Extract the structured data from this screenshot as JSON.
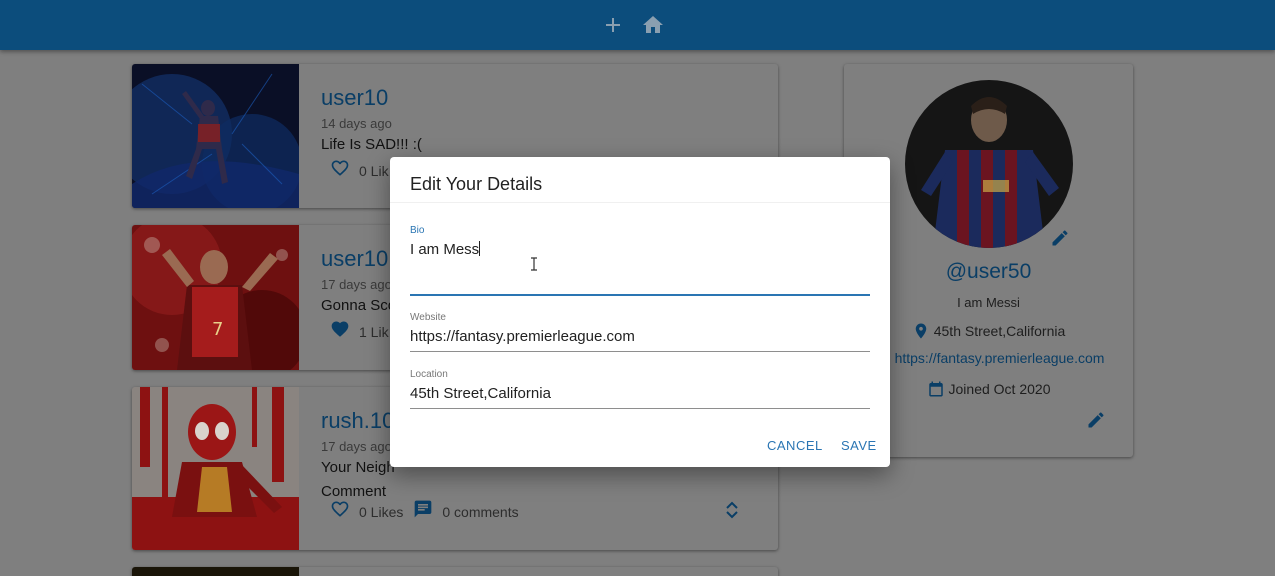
{
  "appbar": {
    "icons": [
      "add-icon",
      "home-icon"
    ]
  },
  "posts": [
    {
      "handle": "user10",
      "date": "14 days ago",
      "text": "Life Is SAD!!! :(",
      "likes_label": "0 Lik",
      "liked": false
    },
    {
      "handle": "user10",
      "date": "17 days ago",
      "text": "Gonna Sco",
      "likes_label": "1 Lik",
      "liked": true
    },
    {
      "handle": "rush.10",
      "date": "17 days ago",
      "text_line1": "Your Neigh",
      "text_line2": "Comment",
      "likes_label": "0 Likes",
      "comments_label": "0 comments",
      "liked": false
    }
  ],
  "profile": {
    "handle": "@user50",
    "bio": "I am Messi",
    "location": "45th Street,California",
    "website": "https://fantasy.premierleague.com",
    "joined": "Joined Oct 2020"
  },
  "dialog": {
    "title": "Edit Your Details",
    "bio_label": "Bio",
    "bio_value": "I am Mess",
    "website_label": "Website",
    "website_value": "https://fantasy.premierleague.com",
    "location_label": "Location",
    "location_value": "45th Street,California",
    "cancel_label": "CANCEL",
    "save_label": "SAVE"
  },
  "colors": {
    "appbar": "#0c4d7c",
    "brand_blue": "#0a3e66",
    "accent": "#2a75b3",
    "overlay": "#7f7f7f"
  }
}
